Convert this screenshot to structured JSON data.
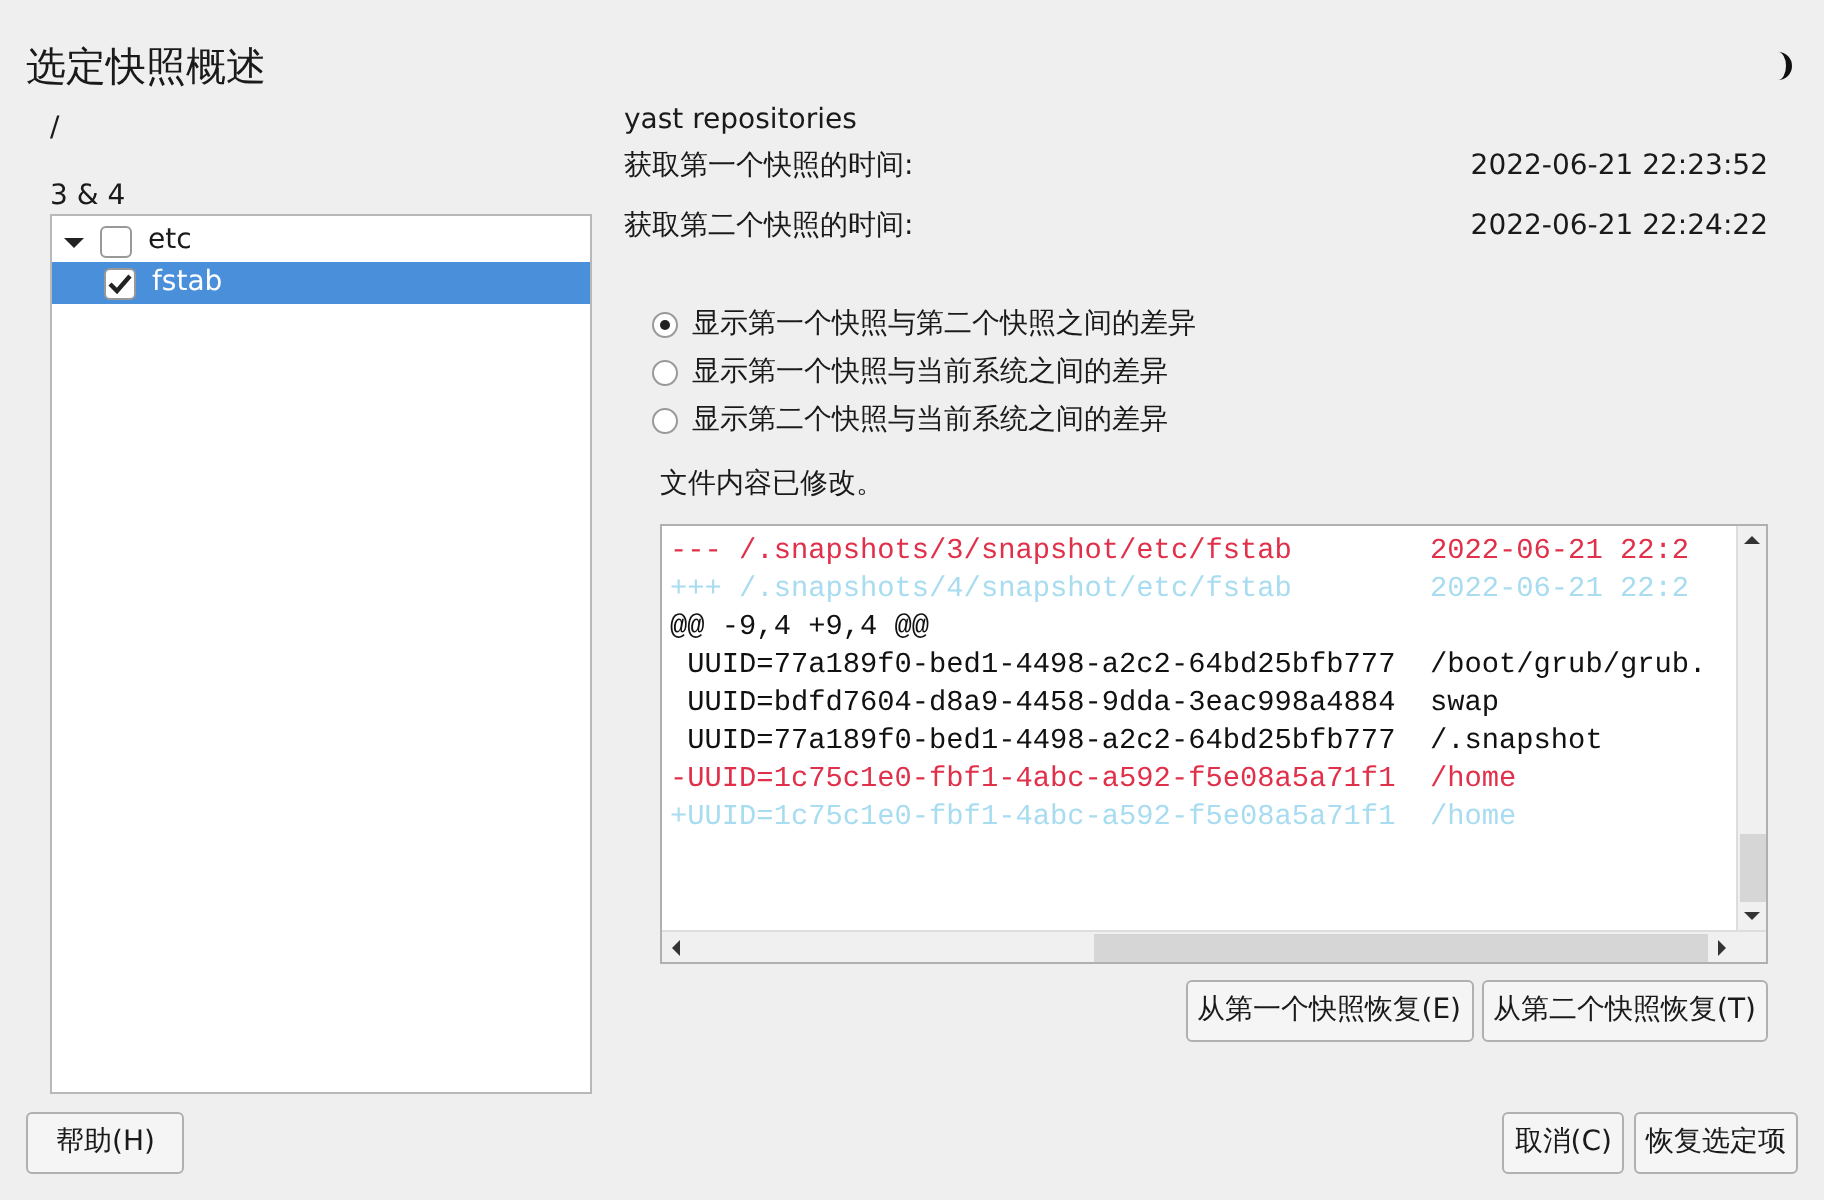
{
  "window": {
    "title": "选定快照概述"
  },
  "left": {
    "path": "/",
    "snapshots": "3 & 4",
    "tree": [
      {
        "label": "etc",
        "expanded": true,
        "checked": false,
        "selected": false,
        "children": [
          {
            "label": "fstab",
            "checked": true,
            "selected": true
          }
        ]
      }
    ]
  },
  "info": {
    "description": "yast repositories",
    "rows": [
      {
        "label": "获取第一个快照的时间:",
        "value": "2022-06-21 22:23:52"
      },
      {
        "label": "获取第二个快照的时间:",
        "value": "2022-06-21 22:24:22"
      }
    ]
  },
  "options": [
    {
      "label": "显示第一个快照与第二个快照之间的差异",
      "selected": true
    },
    {
      "label": "显示第一个快照与当前系统之间的差异",
      "selected": false
    },
    {
      "label": "显示第二个快照与当前系统之间的差异",
      "selected": false
    }
  ],
  "status": "文件内容已修改。",
  "diff": [
    {
      "kind": "removed",
      "text": "--- /.snapshots/3/snapshot/etc/fstab        2022-06-21 22:2"
    },
    {
      "kind": "added",
      "text": "+++ /.snapshots/4/snapshot/etc/fstab        2022-06-21 22:2"
    },
    {
      "kind": "context",
      "text": "@@ -9,4 +9,4 @@"
    },
    {
      "kind": "context",
      "text": " UUID=77a189f0-bed1-4498-a2c2-64bd25bfb777  /boot/grub/grub."
    },
    {
      "kind": "context",
      "text": " UUID=bdfd7604-d8a9-4458-9dda-3eac998a4884  swap"
    },
    {
      "kind": "context",
      "text": " UUID=77a189f0-bed1-4498-a2c2-64bd25bfb777  /.snapshot"
    },
    {
      "kind": "removed",
      "text": "-UUID=1c75c1e0-fbf1-4abc-a592-f5e08a5a71f1  /home"
    },
    {
      "kind": "added",
      "text": "+UUID=1c75c1e0-fbf1-4abc-a592-f5e08a5a71f1  /home"
    }
  ],
  "restore_buttons": [
    "从第一个快照恢复(E)",
    "从第二个快照恢复(T)"
  ],
  "footer": {
    "help": "帮助(H)",
    "buttons": [
      "取消(C)",
      "恢复选定项"
    ]
  }
}
